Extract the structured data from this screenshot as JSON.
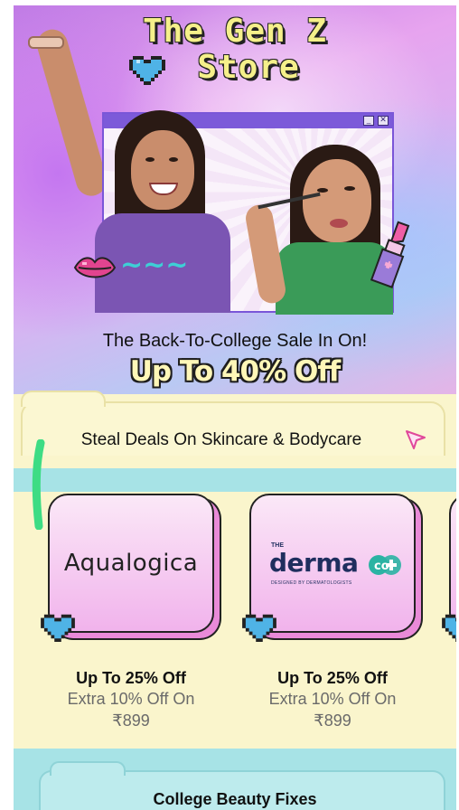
{
  "hero": {
    "title_line1": "The Gen Z",
    "title_line2": "Store",
    "sale_line1": "The Back-To-College Sale In On!",
    "sale_line2": "Up To 40% Off"
  },
  "deals": {
    "heading": "Steal Deals On Skincare & Bodycare",
    "brands": [
      {
        "name": "Aqualogica",
        "offer": "Up To 25% Off",
        "extra": "Extra 10% Off On",
        "price": "₹899"
      },
      {
        "name": "the derma co",
        "offer": "Up To 25% Off",
        "extra": "Extra 10% Off On",
        "price": "₹899"
      }
    ]
  },
  "logos": {
    "aqualogica": "Aqualogica",
    "derma_the": "THE",
    "derma_main": "derma",
    "derma_co": "co",
    "derma_tagline": "DESIGNED BY DERMATOLOGISTS"
  },
  "next_section": {
    "heading": "College Beauty Fixes"
  },
  "colors": {
    "title_yellow": "#f5f08a",
    "card_pink": "#f1b3ec",
    "deals_bg": "#faf5cc",
    "cyan_band": "#a7e3e6",
    "popup_purple": "#7c5ad9",
    "heart_blue": "#4fb3e6"
  },
  "icons": [
    "pixel-heart-icon",
    "lips-icon",
    "lipstick-icon",
    "cursor-arrow-icon",
    "minimize-icon",
    "close-icon"
  ]
}
